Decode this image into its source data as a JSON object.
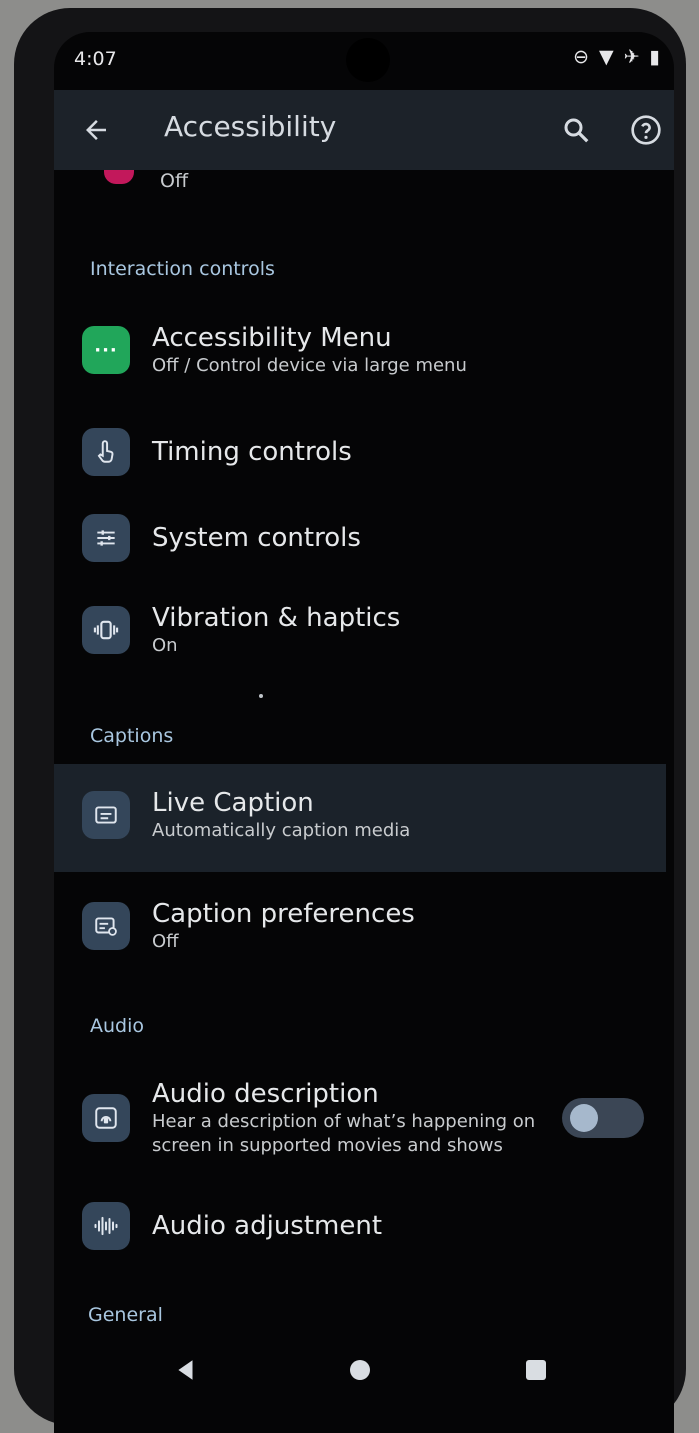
{
  "status": {
    "time": "4:07"
  },
  "appbar": {
    "title": "Accessibility",
    "back_icon": "back-arrow-icon",
    "search_icon": "search-icon",
    "help_icon": "help-icon"
  },
  "partial_item": {
    "subtitle": "Off"
  },
  "sections": {
    "interaction": "Interaction controls",
    "captions": "Captions",
    "audio": "Audio",
    "general": "General"
  },
  "items": {
    "accessibility_menu": {
      "title": "Accessibility Menu",
      "subtitle": "Off / Control device via large menu"
    },
    "timing_controls": {
      "title": "Timing controls"
    },
    "system_controls": {
      "title": "System controls"
    },
    "vibration": {
      "title": "Vibration & haptics",
      "subtitle": "On"
    },
    "live_caption": {
      "title": "Live Caption",
      "subtitle": "Automatically caption media"
    },
    "caption_prefs": {
      "title": "Caption preferences",
      "subtitle": "Off"
    },
    "audio_description": {
      "title": "Audio description",
      "subtitle_line1": "Hear a description of what’s happening on",
      "subtitle_line2": "screen in supported movies and shows",
      "toggle_on": false
    },
    "audio_adjustment": {
      "title": "Audio adjustment"
    }
  },
  "colors": {
    "accent_green": "#21a65a",
    "tile": "#34465a",
    "section_text": "#a9c7e0",
    "appbar": "#1c2229"
  }
}
